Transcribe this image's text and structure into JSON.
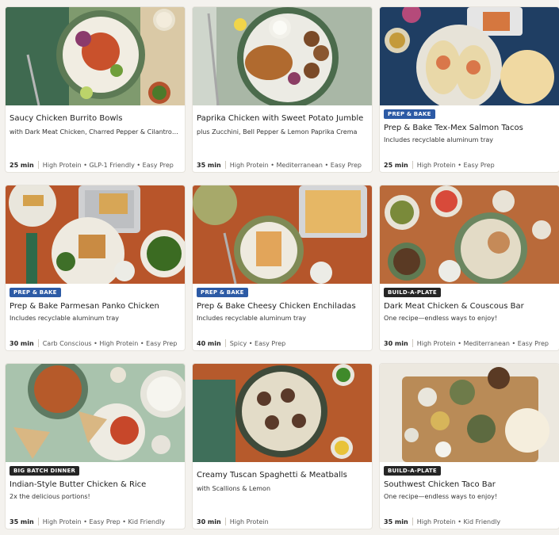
{
  "cards": [
    {
      "title": "Saucy Chicken Burrito Bowls",
      "subtitle": "with Dark Meat Chicken, Charred Pepper & Cilantro Rice",
      "badge": "",
      "time": "25 min",
      "tags": "High Protein • GLP-1 Friendly • Easy Prep"
    },
    {
      "title": "Paprika Chicken with Sweet Potato Jumble",
      "subtitle": "plus Zucchini, Bell Pepper & Lemon Paprika Crema",
      "badge": "",
      "time": "35 min",
      "tags": "High Protein • Mediterranean • Easy Prep"
    },
    {
      "title": "Prep & Bake Tex-Mex Salmon Tacos",
      "subtitle": "Includes recyclable aluminum tray",
      "badge": "PREP & BAKE",
      "time": "25 min",
      "tags": "High Protein • Easy Prep"
    },
    {
      "title": "Prep & Bake Parmesan Panko Chicken",
      "subtitle": "Includes recyclable aluminum tray",
      "badge": "PREP & BAKE",
      "time": "30 min",
      "tags": "Carb Conscious • High Protein • Easy Prep"
    },
    {
      "title": "Prep & Bake Cheesy Chicken Enchiladas",
      "subtitle": "Includes recyclable aluminum tray",
      "badge": "PREP & BAKE",
      "time": "40 min",
      "tags": "Spicy • Easy Prep"
    },
    {
      "title": "Dark Meat Chicken & Couscous Bar",
      "subtitle": "One recipe—endless ways to enjoy!",
      "badge": "BUILD-A-PLATE",
      "time": "30 min",
      "tags": "High Protein • Mediterranean • Easy Prep"
    },
    {
      "title": "Indian-Style Butter Chicken & Rice",
      "subtitle": "2x the delicious portions!",
      "badge": "BIG BATCH DINNER",
      "time": "35 min",
      "tags": "High Protein • Easy Prep • Kid Friendly"
    },
    {
      "title": "Creamy Tuscan Spaghetti & Meatballs",
      "subtitle": "with Scallions & Lemon",
      "badge": "",
      "time": "30 min",
      "tags": "High Protein"
    },
    {
      "title": "Southwest Chicken Taco Bar",
      "subtitle": "One recipe—endless ways to enjoy!",
      "badge": "BUILD-A-PLATE",
      "time": "35 min",
      "tags": "High Protein • Kid Friendly"
    }
  ],
  "colors": {
    "badge_blue": "#2c5aa5",
    "badge_dark": "#252525",
    "page_bg": "#f4f2ee"
  },
  "icons": [
    "plate-photo"
  ]
}
